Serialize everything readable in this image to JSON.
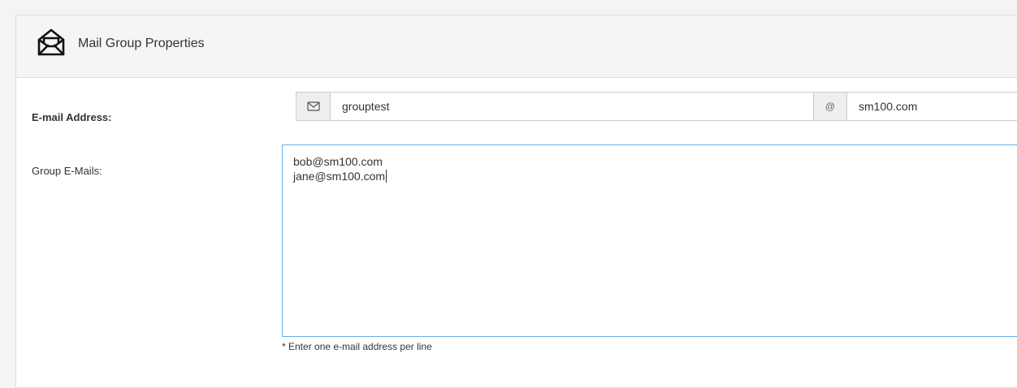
{
  "panel": {
    "title": "Mail Group Properties",
    "icon": "open-envelope-icon"
  },
  "email_address": {
    "label": "E-mail Address:",
    "local_part": "grouptest",
    "at_symbol": "@",
    "domain": "sm100.com",
    "icon": "envelope-icon"
  },
  "group_emails": {
    "label": "Group E-Mails:",
    "lines": [
      "bob@sm100.com",
      "jane@sm100.com"
    ],
    "help": "* Enter one e-mail address per line"
  },
  "colors": {
    "page_background": "#f4f4f4",
    "header_background": "#f5f5f5",
    "border": "#dddddd",
    "addon_background": "#eeeeee",
    "focus_border": "#66afe9",
    "text": "#333333"
  }
}
